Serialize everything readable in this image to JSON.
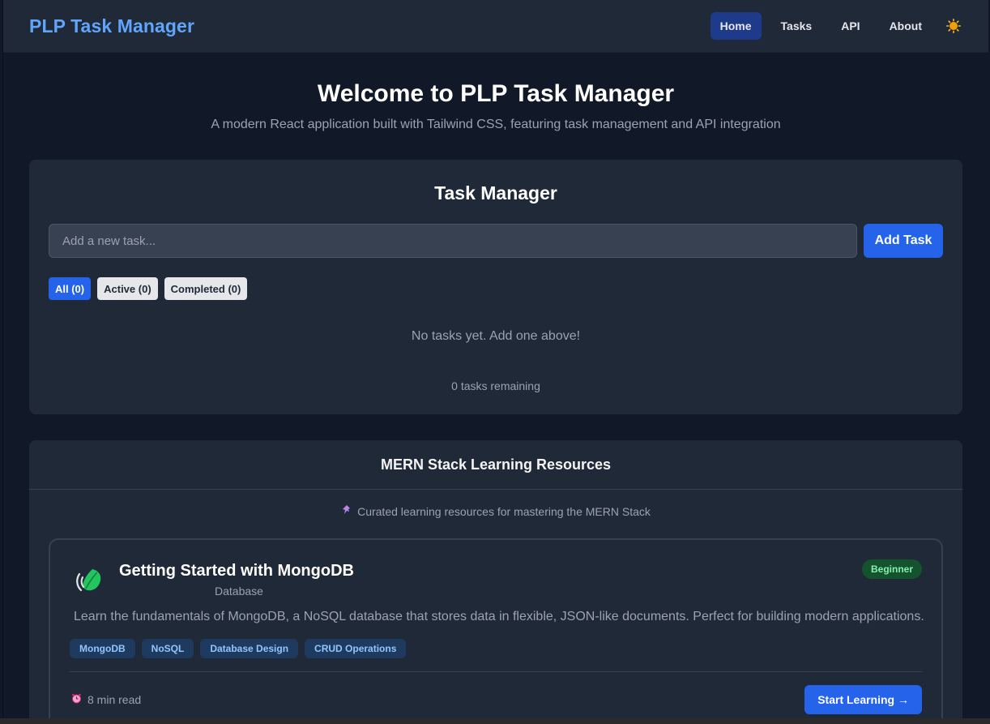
{
  "nav": {
    "brand": "PLP Task Manager",
    "links": [
      "Home",
      "Tasks",
      "API",
      "About"
    ],
    "active": "Home",
    "theme_icon": "sun-icon"
  },
  "hero": {
    "title": "Welcome to PLP Task Manager",
    "subtitle": "A modern React application built with Tailwind CSS, featuring task management and API integration"
  },
  "task_manager": {
    "title": "Task Manager",
    "input_placeholder": "Add a new task...",
    "input_value": "",
    "add_button": "Add Task",
    "filters": [
      "All (0)",
      "Active (0)",
      "Completed (0)"
    ],
    "active_filter": "All (0)",
    "empty_message": "No tasks yet. Add one above!",
    "remaining": "0 tasks remaining"
  },
  "resources": {
    "title": "MERN Stack Learning Resources",
    "subtitle": "Curated learning resources for mastering the MERN Stack",
    "subtitle_icon": "pin-icon",
    "items": [
      {
        "icon": "leaf-icon",
        "title": "Getting Started with MongoDB",
        "category": "Database",
        "level": "Beginner",
        "description": "Learn the fundamentals of MongoDB, a NoSQL database that stores data in flexible, JSON-like documents. Perfect for building modern applications.",
        "tags": [
          "MongoDB",
          "NoSQL",
          "Database Design",
          "CRUD Operations"
        ],
        "read_time": "8 min read",
        "read_icon": "clock-icon",
        "cta": "Start Learning →"
      }
    ]
  },
  "colors": {
    "background": "#111827",
    "surface": "#1f2937",
    "accent": "#2563eb",
    "brand": "#60a5fa",
    "badge_green": "#14532d"
  }
}
